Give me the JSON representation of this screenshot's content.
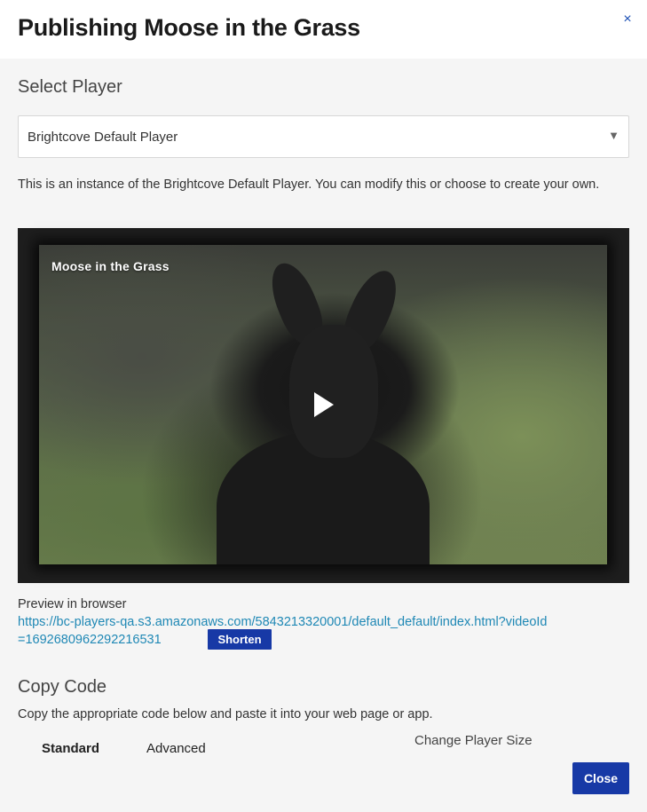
{
  "modal": {
    "title": "Publishing Moose in the Grass",
    "close_icon_glyph": "×"
  },
  "select_player": {
    "heading": "Select Player",
    "selected": "Brightcove Default Player",
    "caret_glyph": "▼",
    "description": "This is an instance of the Brightcove Default Player. You can modify this or choose to create your own."
  },
  "video": {
    "title": "Moose in the Grass",
    "play_icon": "play-icon"
  },
  "preview": {
    "label": "Preview in browser",
    "url": "https://bc-players-qa.s3.amazonaws.com/5843213320001/default_default/index.html?videoId=1692680962292216531",
    "shorten_label": "Shorten"
  },
  "copy_code": {
    "heading": "Copy Code",
    "description": "Copy the appropriate code below and paste it into your web page or app.",
    "tabs": [
      {
        "label": "Standard",
        "active": true
      },
      {
        "label": "Advanced",
        "active": false
      }
    ],
    "change_size_label": "Change Player Size"
  },
  "footer": {
    "close_label": "Close"
  },
  "colors": {
    "accent": "#1739a6",
    "link": "#1f88b5",
    "close_icon": "#1a4fb4"
  }
}
